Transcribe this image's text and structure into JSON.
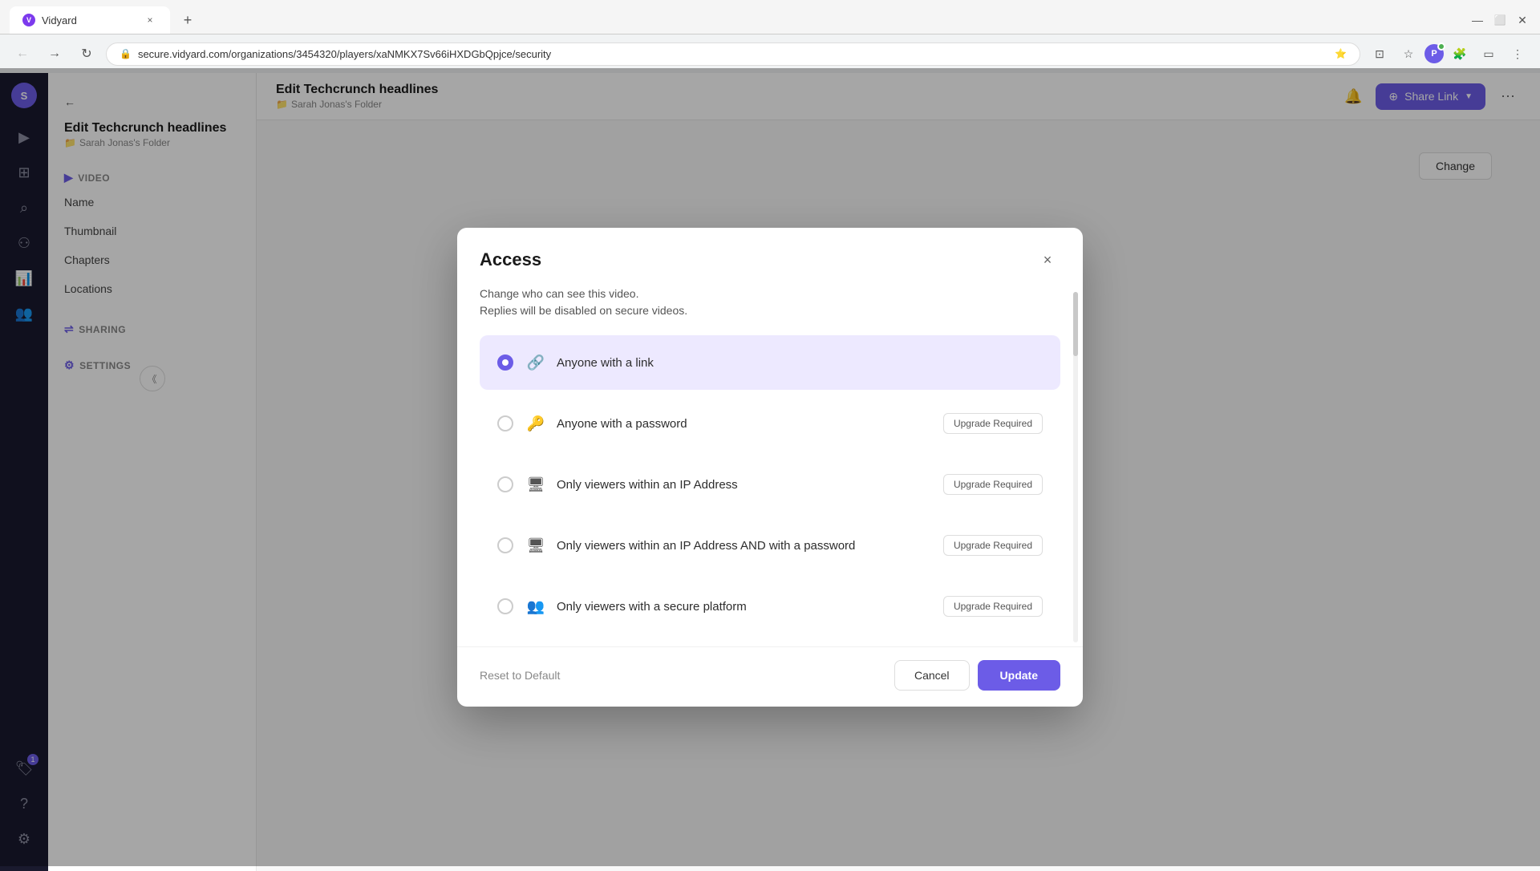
{
  "browser": {
    "tab": {
      "favicon_text": "V",
      "title": "Vidyard",
      "close_label": "×",
      "new_tab_label": "+"
    },
    "toolbar": {
      "back_label": "←",
      "forward_label": "→",
      "refresh_label": "↻",
      "url": "secure.vidyard.com/organizations/3454320/players/xaNMKX7Sv66iHXDGbQpjce/security",
      "profile_label": "P"
    }
  },
  "icon_sidebar": {
    "items": [
      {
        "id": "play",
        "icon": "▶",
        "active": false
      },
      {
        "id": "grid",
        "icon": "⊞",
        "active": false
      },
      {
        "id": "search",
        "icon": "⌕",
        "active": false
      },
      {
        "id": "users",
        "icon": "⚇",
        "active": false
      },
      {
        "id": "analytics",
        "icon": "⚡",
        "active": false
      },
      {
        "id": "team",
        "icon": "⊕",
        "active": false
      }
    ],
    "bottom_items": [
      {
        "id": "badge",
        "icon": "⊕",
        "badge": "1"
      },
      {
        "id": "help",
        "icon": "?"
      },
      {
        "id": "settings",
        "icon": "⚙"
      }
    ],
    "avatar_text": "S"
  },
  "nav_sidebar": {
    "back_label": "←",
    "title": "Edit Techcrunch headlines",
    "folder_label": "Sarah Jonas's Folder",
    "sections": [
      {
        "id": "video",
        "icon": "▶",
        "header": "VIDEO",
        "items": [
          {
            "id": "name",
            "label": "Name",
            "active": false
          },
          {
            "id": "thumbnail",
            "label": "Thumbnail",
            "active": false
          },
          {
            "id": "chapters",
            "label": "Chapters",
            "active": false
          },
          {
            "id": "locations",
            "label": "Locations",
            "active": false
          }
        ]
      },
      {
        "id": "sharing",
        "icon": "⇌",
        "header": "SHARING",
        "items": []
      },
      {
        "id": "settings",
        "icon": "⚙",
        "header": "SETTINGS",
        "items": []
      }
    ]
  },
  "topbar": {
    "title": "Edit Techcrunch headlines",
    "folder_icon": "📁",
    "folder_label": "Sarah Jonas's Folder",
    "notification_icon": "🔔",
    "share_link_label": "Share Link",
    "share_icon": "⊕",
    "more_icon": "⋯",
    "change_button_label": "Change"
  },
  "modal": {
    "title": "Access",
    "close_label": "×",
    "description_line1": "Change who can see this video.",
    "description_line2": "Replies will be disabled on secure videos.",
    "options": [
      {
        "id": "anyone-link",
        "icon": "🔗",
        "label": "Anyone with a link",
        "selected": true,
        "upgrade_required": false,
        "upgrade_label": ""
      },
      {
        "id": "password",
        "icon": "🔑",
        "label": "Anyone with a password",
        "selected": false,
        "upgrade_required": true,
        "upgrade_label": "Upgrade Required"
      },
      {
        "id": "ip-address",
        "icon": "🖥",
        "label": "Only viewers within an IP Address",
        "selected": false,
        "upgrade_required": true,
        "upgrade_label": "Upgrade Required"
      },
      {
        "id": "ip-address-password",
        "icon": "🖥",
        "label": "Only viewers within an IP Address AND with a password",
        "selected": false,
        "upgrade_required": true,
        "upgrade_label": "Upgrade Required"
      },
      {
        "id": "secure-platform",
        "icon": "👥",
        "label": "Only viewers with a secure platform",
        "selected": false,
        "upgrade_required": true,
        "upgrade_label": "Upgrade Required"
      }
    ],
    "reset_label": "Reset to Default",
    "cancel_label": "Cancel",
    "update_label": "Update"
  }
}
